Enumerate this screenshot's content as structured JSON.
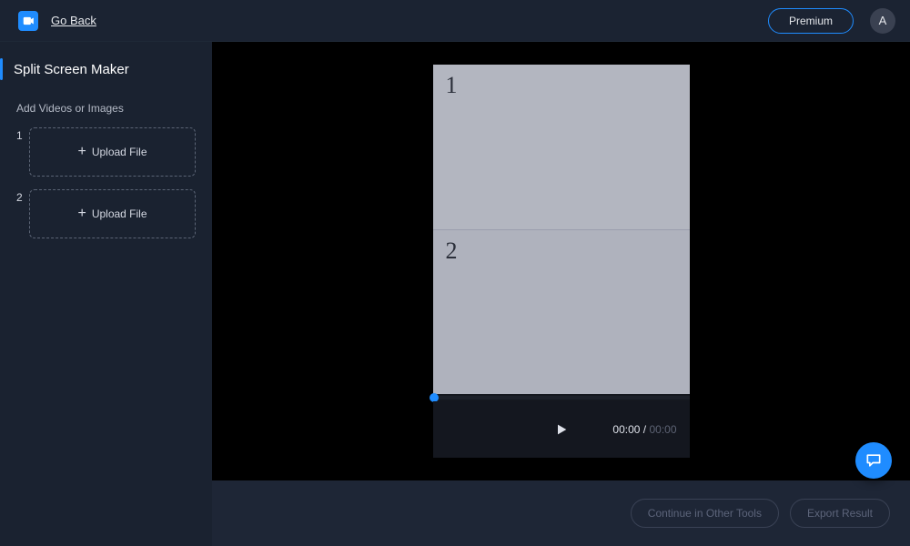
{
  "topbar": {
    "go_back": "Go Back",
    "premium": "Premium",
    "avatar_initial": "A"
  },
  "sidebar": {
    "title": "Split Screen Maker",
    "subtitle": "Add Videos or Images",
    "slots": [
      {
        "num": "1",
        "label": "Upload File"
      },
      {
        "num": "2",
        "label": "Upload File"
      }
    ]
  },
  "preview": {
    "panes": [
      {
        "label": "1"
      },
      {
        "label": "2"
      }
    ],
    "time_current": "00:00",
    "time_separator": " / ",
    "time_duration": "00:00"
  },
  "footer": {
    "continue": "Continue in Other Tools",
    "export": "Export Result"
  }
}
